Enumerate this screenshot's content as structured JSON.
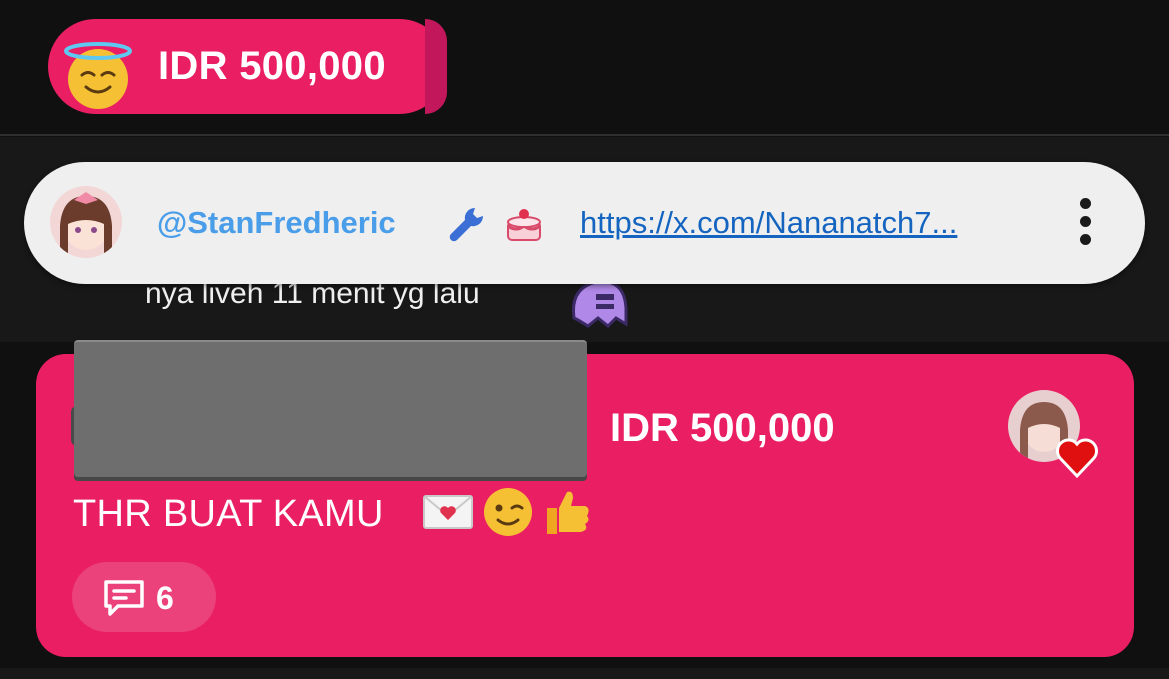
{
  "pinned_chip": {
    "amount": "IDR 500,000",
    "icon": "smiling-face-with-halo-icon",
    "color": "#e91e63"
  },
  "previous_message": {
    "text": "nya liveh 11 menit yg lalu",
    "icon": "pleading-ghost-sticker-icon"
  },
  "pill": {
    "username": "@StanFredheric",
    "badges": [
      "wrench-icon",
      "cake-icon"
    ],
    "link": "https://x.com/Nananatch7...",
    "menu_icon": "more-vertical-icon"
  },
  "donation_card": {
    "amount": "IDR 500,000",
    "message": "THR BUAT KAMU",
    "message_emojis": [
      "love-letter-icon",
      "winking-face-icon",
      "thumbs-up-icon"
    ],
    "reply_count": "6",
    "reply_icon": "comment-icon",
    "accent": "#e91e63"
  }
}
